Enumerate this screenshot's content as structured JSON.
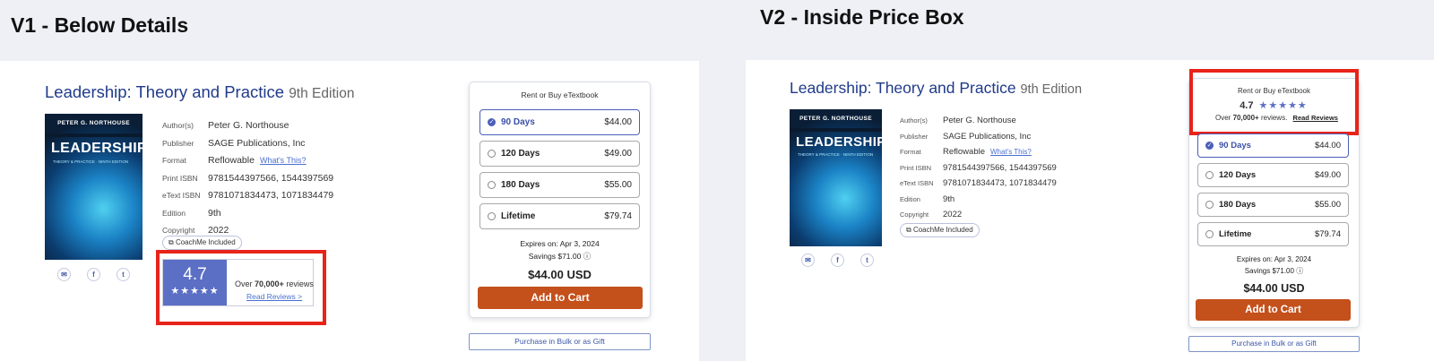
{
  "v1": {
    "title": "V1 - Below Details"
  },
  "v2": {
    "title": "V2 - Inside Price Box"
  },
  "book": {
    "title": "Leadership: Theory and Practice",
    "edition_label": "9th Edition",
    "cover": {
      "author": "PETER G. NORTHOUSE",
      "title": "LEADERSHIP",
      "subtitle": "THEORY & PRACTICE · NINTH EDITION"
    },
    "details": [
      {
        "key": "Author(s)",
        "value": "Peter G. Northouse"
      },
      {
        "key": "Publisher",
        "value": "SAGE Publications, Inc"
      },
      {
        "key": "Format",
        "value": "Reflowable",
        "link": "What's This?"
      },
      {
        "key": "Print ISBN",
        "value": "9781544397566, 1544397569"
      },
      {
        "key": "eText ISBN",
        "value": "9781071834473, 1071834479"
      },
      {
        "key": "Edition",
        "value": "9th"
      },
      {
        "key": "Copyright",
        "value": "2022"
      }
    ],
    "chip": "CoachMe Included"
  },
  "share_icons": [
    "email-icon",
    "facebook-icon",
    "twitter-icon"
  ],
  "rating": {
    "score": "4.7",
    "stars": 4.7,
    "reviews_prefix": "Over",
    "reviews_count": "70,000+",
    "reviews_suffix": "reviews",
    "v2_reviews_suffix": "reviews.",
    "read_v1": "Read Reviews >",
    "read_v2": "Read Reviews"
  },
  "price_box": {
    "header": "Rent or Buy eTextbook",
    "options": [
      {
        "label": "90 Days",
        "price": "$44.00",
        "selected": true
      },
      {
        "label": "120 Days",
        "price": "$49.00",
        "selected": false
      },
      {
        "label": "180 Days",
        "price": "$55.00",
        "selected": false
      },
      {
        "label": "Lifetime",
        "price": "$79.74",
        "selected": false
      }
    ],
    "expires": "Expires on: Apr 3, 2024",
    "savings": "Savings $71.00",
    "total": "$44.00 USD",
    "cart": "Add to Cart",
    "bulk": "Purchase in Bulk or as Gift"
  },
  "colors": {
    "accent": "#c4501b",
    "highlight": "#e8231a",
    "rating_bg": "#5b6fc4",
    "title": "#1f3a8a"
  }
}
